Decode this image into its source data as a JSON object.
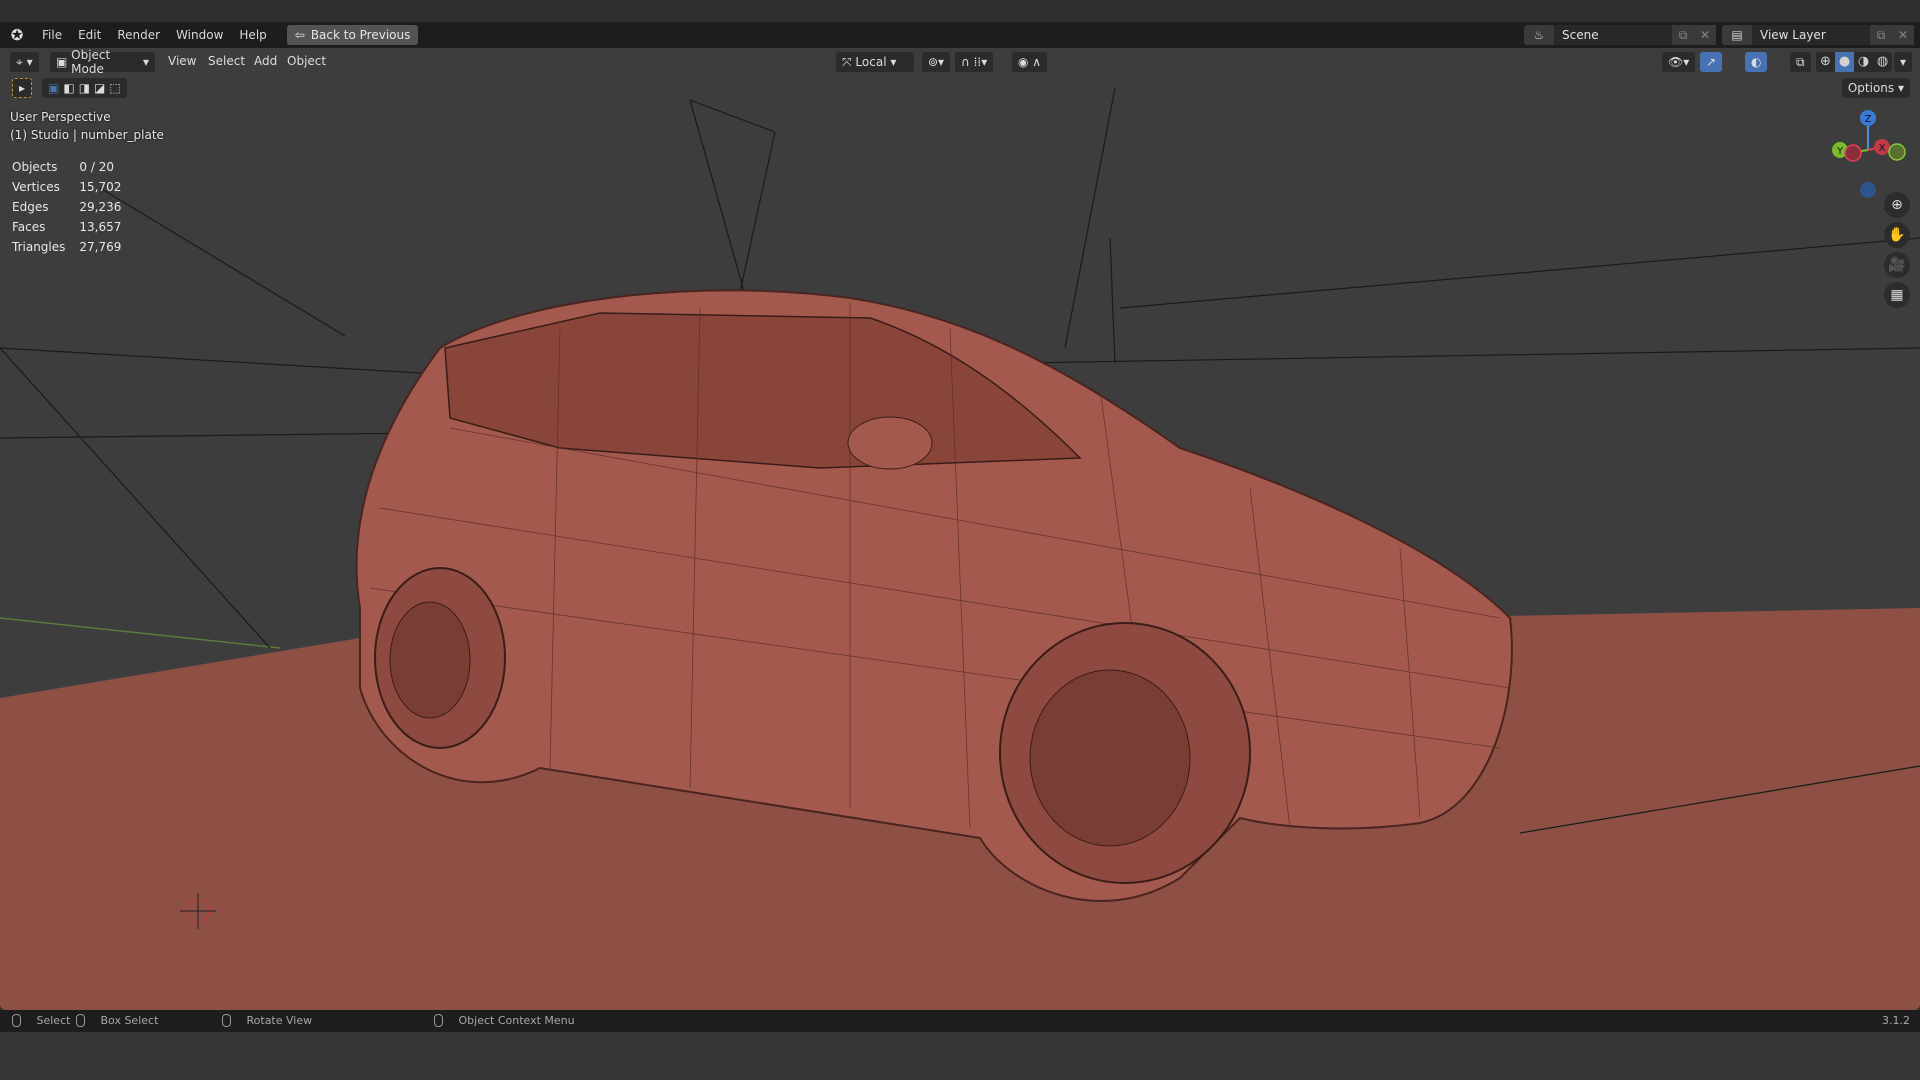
{
  "menubar": {
    "items": [
      "File",
      "Edit",
      "Render",
      "Window",
      "Help"
    ],
    "back_button": "Back to Previous",
    "scene": "Scene",
    "view_layer": "View Layer"
  },
  "viewport_header": {
    "mode": "Object Mode",
    "menus": [
      "View",
      "Select",
      "Add",
      "Object"
    ],
    "transform_orientation": "Local",
    "options": "Options"
  },
  "overlay": {
    "view_name": "User Perspective",
    "collection": "(1) Studio | number_plate"
  },
  "stats": [
    {
      "label": "Objects",
      "value": "0 / 20"
    },
    {
      "label": "Vertices",
      "value": "15,702"
    },
    {
      "label": "Edges",
      "value": "29,236"
    },
    {
      "label": "Faces",
      "value": "13,657"
    },
    {
      "label": "Triangles",
      "value": "27,769"
    }
  ],
  "gizmo": {
    "z": "Z",
    "y": "Y",
    "x": "X"
  },
  "statusbar": {
    "select": "Select",
    "box_select": "Box Select",
    "rotate": "Rotate View",
    "context": "Object Context Menu",
    "version": "3.1.2"
  },
  "colors": {
    "accent": "#4772b3",
    "floor": "#8e4f45",
    "car": "#a3594d"
  }
}
